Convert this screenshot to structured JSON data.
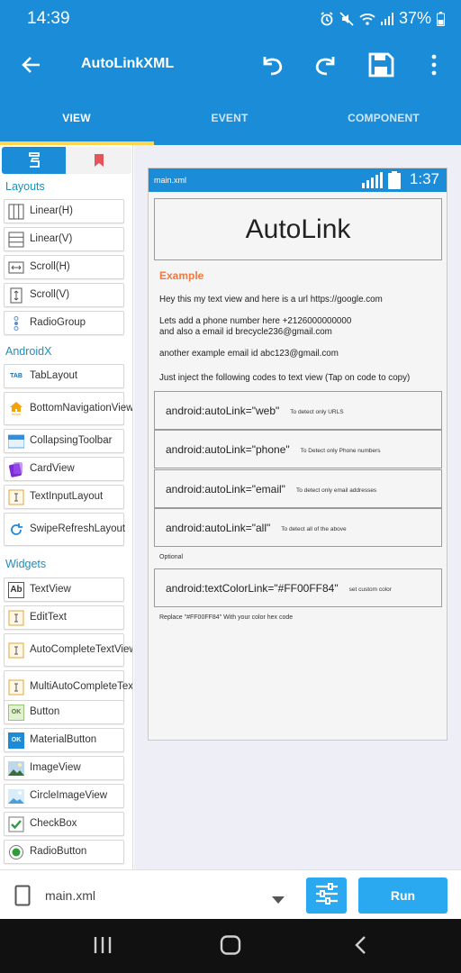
{
  "status_bar": {
    "time": "14:39",
    "battery": "37%"
  },
  "app_bar": {
    "title": "AutoLinkXML"
  },
  "tabs": [
    {
      "label": "VIEW",
      "active": true
    },
    {
      "label": "EVENT",
      "active": false
    },
    {
      "label": "COMPONENT",
      "active": false
    }
  ],
  "palette": {
    "sections": {
      "layouts": "Layouts",
      "androidx": "AndroidX",
      "widgets": "Widgets"
    },
    "layouts": [
      "Linear(H)",
      "Linear(V)",
      "Scroll(H)",
      "Scroll(V)",
      "RadioGroup"
    ],
    "androidx": [
      "TabLayout",
      "BottomNavigationView",
      "CollapsingToolbar",
      "CardView",
      "TextInputLayout",
      "SwipeRefreshLayout"
    ],
    "widgets": [
      "TextView",
      "EditText",
      "AutoCompleteTextView",
      "MultiAutoCompleteTextView",
      "Button",
      "MaterialButton",
      "ImageView",
      "CircleImageView",
      "CheckBox",
      "RadioButton"
    ],
    "icon_texts": {
      "tab": "TAB",
      "ab": "Ab",
      "ok": "OK",
      "home": "Home"
    }
  },
  "device": {
    "file_name": "main.xml",
    "time": "1:37",
    "heading": "AutoLink",
    "example_label": "Example",
    "paragraphs": {
      "url": "Hey this my text view and here is a url https://google.com",
      "phone_1": "Lets add a phone number here +2126000000000",
      "phone_2": "and also a email id brecycle236@gmail.com",
      "email": "another example email id abc123@gmail.com",
      "inject": "Just inject the following codes to text view (Tap on code to copy)"
    },
    "codes": [
      {
        "code": "android:autoLink=\"web\"",
        "desc": "To detect only URLS"
      },
      {
        "code": "android:autoLink=\"phone\"",
        "desc": "To Detect only Phone numbers"
      },
      {
        "code": "android:autoLink=\"email\"",
        "desc": "To detect only email addresses"
      },
      {
        "code": "android:autoLink=\"all\"",
        "desc": "To detect all of the above"
      }
    ],
    "optional_label": "Optional",
    "color_code": {
      "code": "android:textColorLink=\"#FF00FF84\"",
      "desc": "set custom color"
    },
    "replace_note": "Replace \"#FF00FF84\" With your color hex code"
  },
  "bottom_bar": {
    "file_name": "main.xml",
    "run_label": "Run"
  },
  "colors": {
    "primary": "#1a8cd8",
    "accent_button": "#2aa8f0",
    "example_orange": "#f07a3f",
    "section_teal": "#1e8fbd",
    "tab_indicator": "#ffd54f"
  }
}
